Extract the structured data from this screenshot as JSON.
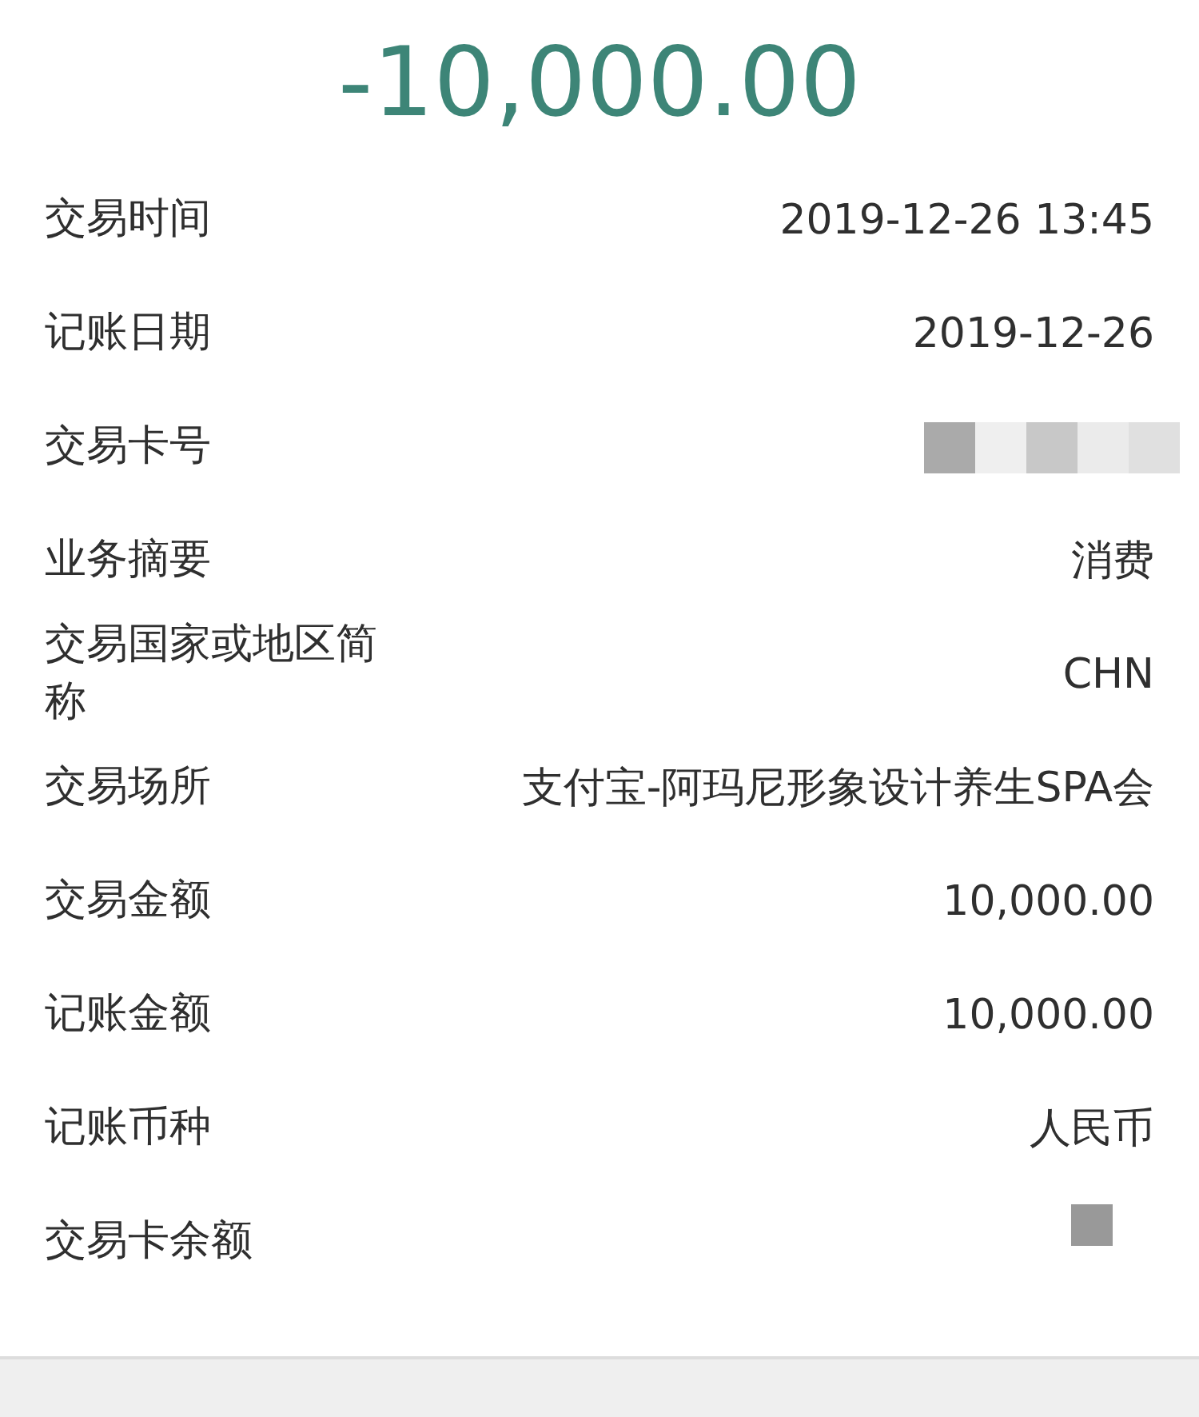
{
  "amount": "-10,000.00",
  "rows": [
    {
      "label": "交易时间",
      "kind": "text",
      "value": "2019-12-26 13:45"
    },
    {
      "label": "记账日期",
      "kind": "text",
      "value": "2019-12-26"
    },
    {
      "label": "交易卡号",
      "kind": "redacted-long"
    },
    {
      "label": "业务摘要",
      "kind": "text",
      "value": "消费"
    },
    {
      "label": "交易国家或地区简称",
      "kind": "text",
      "value": "CHN"
    },
    {
      "label": "交易场所",
      "kind": "text",
      "value": "支付宝-阿玛尼形象设计养生SPA会"
    },
    {
      "label": "交易金额",
      "kind": "text",
      "value": "10,000.00"
    },
    {
      "label": "记账金额",
      "kind": "text",
      "value": "10,000.00"
    },
    {
      "label": "记账币种",
      "kind": "text",
      "value": "人民币"
    },
    {
      "label": "交易卡余额",
      "kind": "redacted-short"
    }
  ]
}
